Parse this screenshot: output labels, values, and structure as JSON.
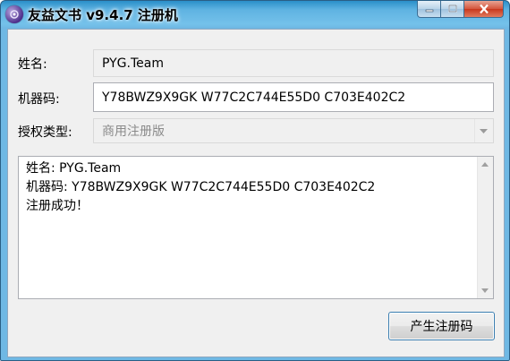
{
  "window": {
    "title": "友益文书 v9.4.7 注册机",
    "app_icon": "purple-orb-icon"
  },
  "titlebar_buttons": {
    "minimize": "minimize-icon",
    "maximize": "maximize-icon",
    "close": "close-icon"
  },
  "form": {
    "name_label": "姓名:",
    "name_value": "PYG.Team",
    "machine_label": "机器码:",
    "machine_value": "Y78BWZ9X9GK W77C2C744E55D0 C703E402C2",
    "license_label": "授权类型:",
    "license_value": "商用注册版"
  },
  "output": {
    "lines": [
      "姓名: PYG.Team",
      "机器码: Y78BWZ9X9GK W77C2C744E55D0 C703E402C2",
      "注册成功！"
    ]
  },
  "actions": {
    "generate_label": "产生注册码"
  },
  "colors": {
    "title_bar": "#5fb3e2",
    "client_bg": "#f0f0f0",
    "close_button": "#c8381d",
    "button_border": "#3c7fb1"
  }
}
